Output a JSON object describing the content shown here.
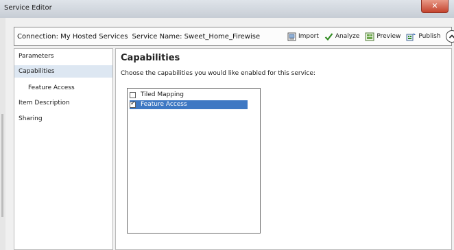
{
  "window": {
    "title": "Service Editor",
    "close_label": "✕"
  },
  "connection": {
    "connection_text": "Connection: My Hosted Services",
    "service_name_text": "Service Name: Sweet_Home_Firewise"
  },
  "toolbar": {
    "import_label": "Import",
    "analyze_label": "Analyze",
    "preview_label": "Preview",
    "publish_label": "Publish"
  },
  "sidebar": {
    "items": [
      {
        "label": "Parameters"
      },
      {
        "label": "Capabilities"
      },
      {
        "label": "Feature Access"
      },
      {
        "label": "Item Description"
      },
      {
        "label": "Sharing"
      }
    ]
  },
  "content": {
    "title": "Capabilities",
    "description": "Choose the capabilities you would like enabled for this service:",
    "capabilities": [
      {
        "label": "Tiled Mapping",
        "checked": false
      },
      {
        "label": "Feature Access",
        "checked": true,
        "check_mark": "✓"
      }
    ]
  },
  "colors": {
    "selection": "#3e78c3",
    "nav_selected": "#dde7f2",
    "close_button": "#c4432d"
  }
}
